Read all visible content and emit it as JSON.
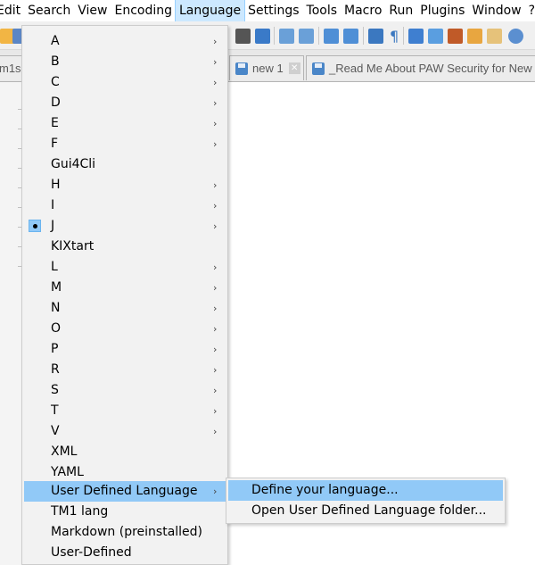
{
  "menubar": {
    "items": [
      {
        "label": "Edit"
      },
      {
        "label": "Search"
      },
      {
        "label": "View"
      },
      {
        "label": "Encoding"
      },
      {
        "label": "Language"
      },
      {
        "label": "Settings"
      },
      {
        "label": "Tools"
      },
      {
        "label": "Macro"
      },
      {
        "label": "Run"
      },
      {
        "label": "Plugins"
      },
      {
        "label": "Window"
      },
      {
        "label": "?"
      }
    ],
    "active": "Language"
  },
  "tabs": [
    {
      "label": "m1s.",
      "partial": true
    },
    {
      "label": "new 1",
      "close": "✕"
    },
    {
      "label": "_Read Me About PAW Security for New M"
    }
  ],
  "language_menu": {
    "items": [
      {
        "label": "A",
        "submenu": true
      },
      {
        "label": "B",
        "submenu": true
      },
      {
        "label": "C",
        "submenu": true
      },
      {
        "label": "D",
        "submenu": true
      },
      {
        "label": "E",
        "submenu": true
      },
      {
        "label": "F",
        "submenu": true
      },
      {
        "label": "Gui4Cli",
        "submenu": false
      },
      {
        "label": "H",
        "submenu": true
      },
      {
        "label": "I",
        "submenu": true
      },
      {
        "label": "J",
        "submenu": true,
        "checked": true
      },
      {
        "label": "KIXtart",
        "submenu": false
      },
      {
        "label": "L",
        "submenu": true
      },
      {
        "label": "M",
        "submenu": true
      },
      {
        "label": "N",
        "submenu": true
      },
      {
        "label": "O",
        "submenu": true
      },
      {
        "label": "P",
        "submenu": true
      },
      {
        "label": "R",
        "submenu": true
      },
      {
        "label": "S",
        "submenu": true
      },
      {
        "label": "T",
        "submenu": true
      },
      {
        "label": "V",
        "submenu": true
      },
      {
        "label": "XML",
        "submenu": false
      },
      {
        "label": "YAML",
        "submenu": false
      },
      {
        "label": "User Defined Language",
        "submenu": true,
        "highlighted": true
      },
      {
        "label": "TM1 lang",
        "submenu": false
      },
      {
        "label": "Markdown (preinstalled)",
        "submenu": false
      },
      {
        "label": "User-Defined",
        "submenu": false
      }
    ],
    "arrow_glyph": "›"
  },
  "user_defined_submenu": {
    "items": [
      {
        "label": "Define your language...",
        "highlighted": true
      },
      {
        "label": "Open User Defined Language folder..."
      }
    ]
  },
  "colors": {
    "menu_bg": "#f2f2f2",
    "highlight": "#91c9f7",
    "menubar_active": "#cce8ff",
    "toolbar_bg": "#f0f0f0"
  }
}
